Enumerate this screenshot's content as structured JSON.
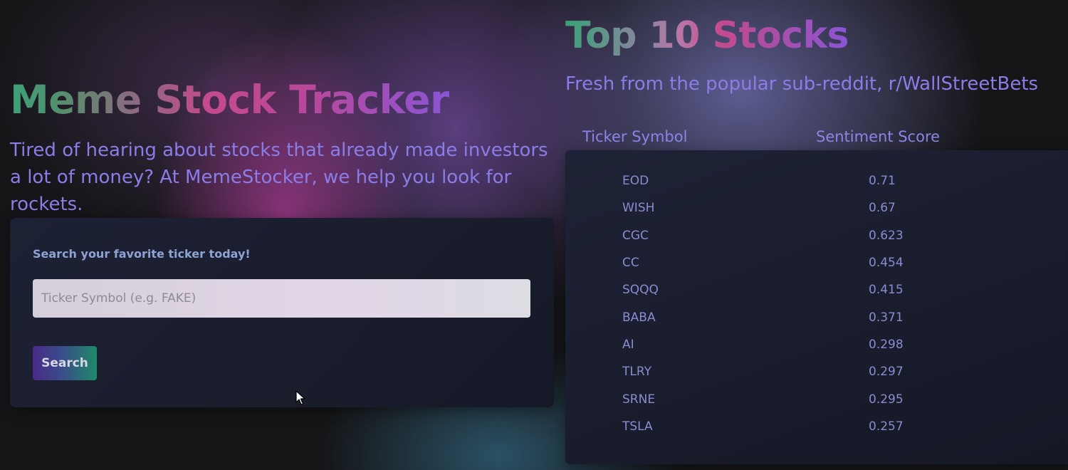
{
  "hero": {
    "title": "Meme Stock Tracker",
    "subtitle": "Tired of hearing about stocks that already made investors a lot of money? At MemeStocker, we help you look for rockets."
  },
  "search": {
    "label": "Search your favorite ticker today!",
    "placeholder": "Ticker Symbol (e.g. FAKE)",
    "value": "",
    "button_label": "Search"
  },
  "top_stocks": {
    "title": "Top 10 Stocks",
    "subtitle": "Fresh from the popular sub-reddit, r/WallStreetBets",
    "headers": {
      "ticker": "Ticker Symbol",
      "score": "Sentiment Score"
    },
    "rows": [
      {
        "symbol": "EOD",
        "score": "0.71"
      },
      {
        "symbol": "WISH",
        "score": "0.67"
      },
      {
        "symbol": "CGC",
        "score": "0.623"
      },
      {
        "symbol": "CC",
        "score": "0.454"
      },
      {
        "symbol": "SQQQ",
        "score": "0.415"
      },
      {
        "symbol": "BABA",
        "score": "0.371"
      },
      {
        "symbol": "AI",
        "score": "0.298"
      },
      {
        "symbol": "TLRY",
        "score": "0.297"
      },
      {
        "symbol": "SRNE",
        "score": "0.295"
      },
      {
        "symbol": "TSLA",
        "score": "0.257"
      }
    ]
  },
  "colors": {
    "accent_text": "#8a7de8",
    "panel_bg": "#1c1f30",
    "title_green": "#3aa277",
    "title_pink": "#c44a8d",
    "title_purple": "#8a55d6"
  },
  "icons": {
    "cursor": "mouse-pointer-icon"
  }
}
